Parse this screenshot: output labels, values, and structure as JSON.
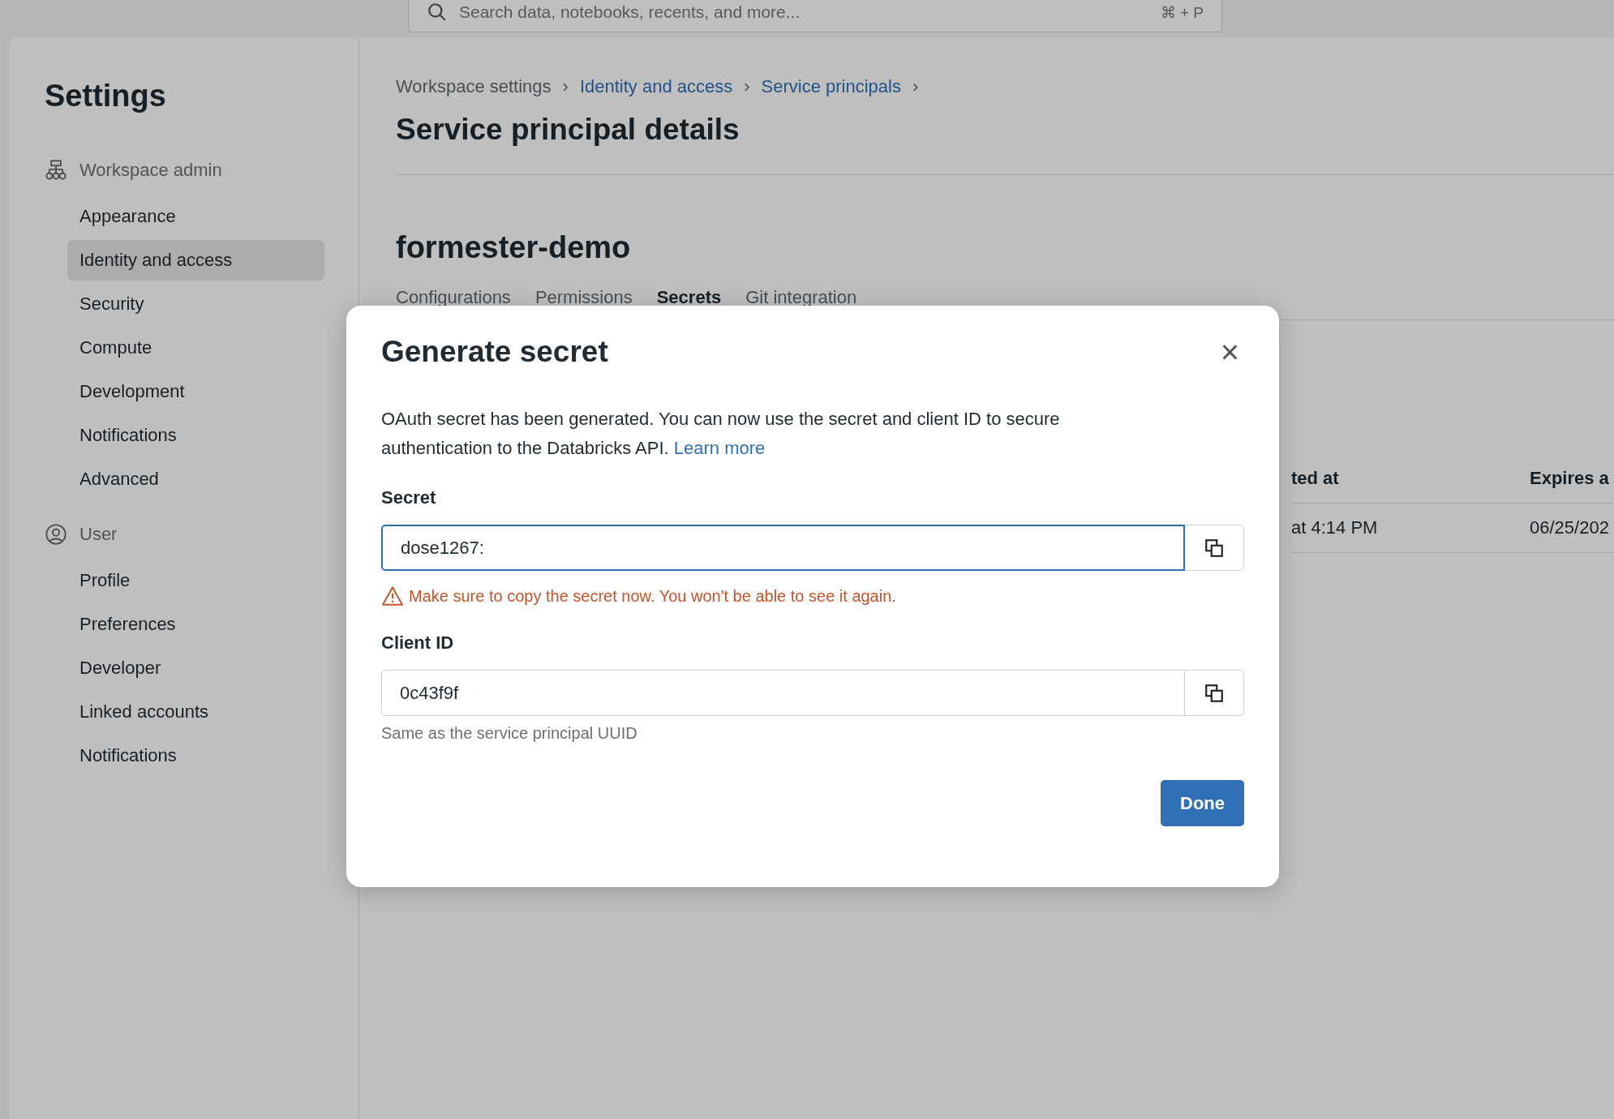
{
  "top_bar": {
    "search": {
      "placeholder": "Search data, notebooks, recents, and more...",
      "shortcut": "⌘ + P"
    }
  },
  "sidebar": {
    "title": "Settings",
    "groups": [
      {
        "label": "Workspace admin",
        "kind": "admin",
        "items": [
          {
            "label": "Appearance",
            "selected": false
          },
          {
            "label": "Identity and access",
            "selected": true
          },
          {
            "label": "Security",
            "selected": false
          },
          {
            "label": "Compute",
            "selected": false
          },
          {
            "label": "Development",
            "selected": false
          },
          {
            "label": "Notifications",
            "selected": false
          },
          {
            "label": "Advanced",
            "selected": false
          }
        ]
      },
      {
        "label": "User",
        "kind": "user",
        "items": [
          {
            "label": "Profile",
            "selected": false
          },
          {
            "label": "Preferences",
            "selected": false
          },
          {
            "label": "Developer",
            "selected": false
          },
          {
            "label": "Linked accounts",
            "selected": false
          },
          {
            "label": "Notifications",
            "selected": false
          }
        ]
      }
    ]
  },
  "main": {
    "breadcrumbs": {
      "separator": "›",
      "items": [
        {
          "label": "Workspace settings",
          "link": false
        },
        {
          "label": "Identity and access",
          "link": true
        },
        {
          "label": "Service principals",
          "link": true
        }
      ]
    },
    "title": "Service principal details",
    "principal_name": "formester-demo",
    "tabs": [
      {
        "label": "Configurations",
        "selected": false
      },
      {
        "label": "Permissions",
        "selected": false
      },
      {
        "label": "Secrets",
        "selected": true
      },
      {
        "label": "Git integration",
        "selected": false
      }
    ],
    "table": {
      "columns": [
        "ted at",
        "Expires a"
      ],
      "rows": [
        [
          "at 4:14 PM",
          "06/25/202"
        ]
      ]
    }
  },
  "dialog": {
    "title": "Generate secret",
    "close": "×",
    "message": "OAuth secret has been generated. You can now use the secret and client ID to secure authentication to the Databricks API.",
    "link": "Learn more",
    "fields": [
      {
        "label": "Secret",
        "value": "dose1267:",
        "focused": true,
        "note": {
          "kind": "warning",
          "text": "Make sure to copy the secret now. You won't be able to see it again."
        }
      },
      {
        "label": "Client ID",
        "value": "0c43f9f",
        "focused": false,
        "note": {
          "kind": "hint",
          "text": "Same as the service principal UUID"
        }
      }
    ],
    "button": "Done"
  }
}
